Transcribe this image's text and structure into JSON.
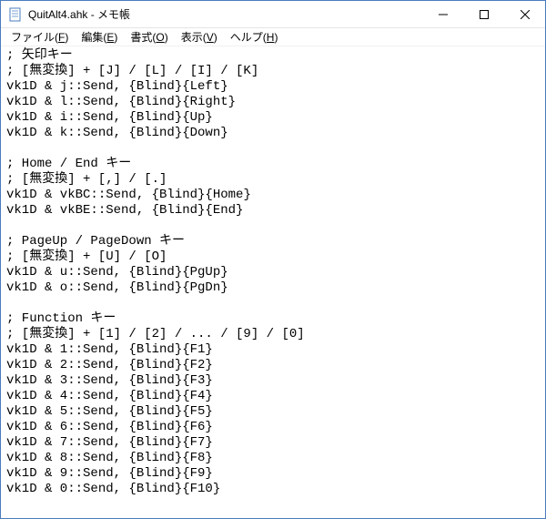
{
  "window": {
    "title": "QuitAlt4.ahk - メモ帳"
  },
  "menu": {
    "file": {
      "label": "ファイル",
      "accel": "F"
    },
    "edit": {
      "label": "編集",
      "accel": "E"
    },
    "format": {
      "label": "書式",
      "accel": "O"
    },
    "view": {
      "label": "表示",
      "accel": "V"
    },
    "help": {
      "label": "ヘルプ",
      "accel": "H"
    }
  },
  "content": "; 矢印キー\n; [無変換] + [J] / [L] / [I] / [K]\nvk1D & j::Send, {Blind}{Left}\nvk1D & l::Send, {Blind}{Right}\nvk1D & i::Send, {Blind}{Up}\nvk1D & k::Send, {Blind}{Down}\n\n; Home / End キー\n; [無変換] + [,] / [.]\nvk1D & vkBC::Send, {Blind}{Home}\nvk1D & vkBE::Send, {Blind}{End}\n\n; PageUp / PageDown キー\n; [無変換] + [U] / [O]\nvk1D & u::Send, {Blind}{PgUp}\nvk1D & o::Send, {Blind}{PgDn}\n\n; Function キー\n; [無変換] + [1] / [2] / ... / [9] / [0]\nvk1D & 1::Send, {Blind}{F1}\nvk1D & 2::Send, {Blind}{F2}\nvk1D & 3::Send, {Blind}{F3}\nvk1D & 4::Send, {Blind}{F4}\nvk1D & 5::Send, {Blind}{F5}\nvk1D & 6::Send, {Blind}{F6}\nvk1D & 7::Send, {Blind}{F7}\nvk1D & 8::Send, {Blind}{F8}\nvk1D & 9::Send, {Blind}{F9}\nvk1D & 0::Send, {Blind}{F10}"
}
